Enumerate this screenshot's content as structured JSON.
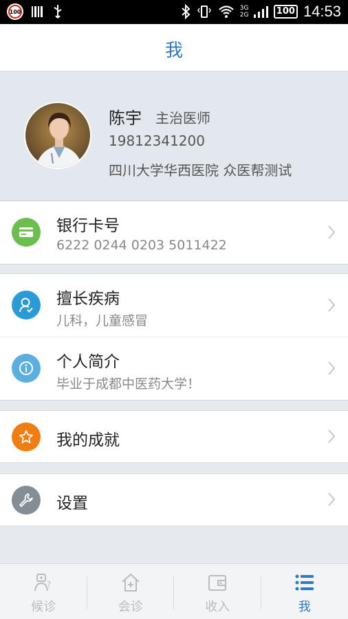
{
  "status_bar": {
    "badge_left": "100",
    "battery": "100",
    "network": "3G 2G",
    "time": "14:53"
  },
  "header": {
    "title": "我"
  },
  "profile": {
    "name": "陈宇",
    "title": "主治医师",
    "phone": "19812341200",
    "hospital": "四川大学华西医院  众医帮测试"
  },
  "menu": {
    "bank": {
      "label": "银行卡号",
      "value": "6222 0244 0203 5011422",
      "icon": "credit-card-icon",
      "color": "#6cbe4e"
    },
    "specialty": {
      "label": "擅长疾病",
      "value": "儿科，儿童感冒",
      "icon": "user-check-icon",
      "color": "#2a9bd6"
    },
    "intro": {
      "label": "个人简介",
      "value": "毕业于成都中医药大学！",
      "icon": "info-icon",
      "color": "#5aaee0"
    },
    "achievement": {
      "label": "我的成就",
      "icon": "star-icon",
      "color": "#f07d12"
    },
    "settings": {
      "label": "设置",
      "icon": "wrench-icon",
      "color": "#858d95"
    }
  },
  "tabs": [
    {
      "label": "候诊",
      "icon": "doctor-question-icon",
      "active": false
    },
    {
      "label": "会诊",
      "icon": "house-plus-icon",
      "active": false
    },
    {
      "label": "收入",
      "icon": "wallet-icon",
      "active": false
    },
    {
      "label": "我",
      "icon": "list-icon",
      "active": true
    }
  ],
  "colors": {
    "accent": "#2f7bc1",
    "inactive_tab": "#b7bcc1"
  }
}
